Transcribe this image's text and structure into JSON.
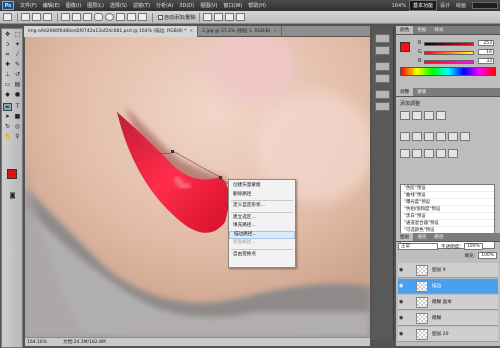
{
  "app": {
    "logo": "Ps"
  },
  "menubar": {
    "items": [
      "文件(F)",
      "编辑(E)",
      "图像(I)",
      "图层(L)",
      "选择(S)",
      "滤镜(T)",
      "分析(A)",
      "3D(D)",
      "视图(V)",
      "窗口(W)",
      "帮助(H)"
    ],
    "zoom": "164%",
    "workspaces": [
      "基本功能",
      "设计",
      "绘画"
    ]
  },
  "options_bar": {
    "auto_add_delete": "自动添加/删除"
  },
  "doc_tabs": [
    {
      "label": "img-a9d2066f6d80ed2f0742a13af24c681.psd @ 164% (描边, RGB/8) *",
      "active": true
    },
    {
      "label": "2.jpg @ 37.2% (图层 1, RGB/8)",
      "active": false
    }
  ],
  "status": {
    "zoom": "164.16%",
    "doc": "文档:24.3M/182.8M"
  },
  "context_menu": [
    {
      "label": "创建矢量蒙版",
      "type": "item"
    },
    {
      "label": "删除路径",
      "type": "item"
    },
    {
      "type": "sep"
    },
    {
      "label": "定义自定形状...",
      "type": "item"
    },
    {
      "type": "sep"
    },
    {
      "label": "建立选区...",
      "type": "item"
    },
    {
      "label": "填充路径...",
      "type": "item"
    },
    {
      "label": "描边路径...",
      "type": "highlighted"
    },
    {
      "label": "剪贴路径...",
      "type": "disabled"
    },
    {
      "type": "sep"
    },
    {
      "label": "自由变换点",
      "type": "item"
    }
  ],
  "color_panel": {
    "tabs": [
      "颜色",
      "色板",
      "样式"
    ],
    "swatch_color": "#fd1012",
    "sliders": [
      {
        "label": "R",
        "value": "253"
      },
      {
        "label": "G",
        "value": "16"
      },
      {
        "label": "B",
        "value": "33"
      }
    ]
  },
  "adjustments_panel": {
    "tabs": [
      "调整",
      "蒙版"
    ],
    "title": "添加调整",
    "presets": [
      "\"色阶\"预设",
      "\"曲线\"预设",
      "\"曝光度\"预设",
      "\"色相/饱和度\"预设",
      "\"黑白\"预设",
      "\"通道混合器\"预设",
      "\"可选颜色\"预设"
    ]
  },
  "layers_panel": {
    "tabs": [
      "图层",
      "通道",
      "路径"
    ],
    "blend_mode": "正常",
    "opacity_label": "不透明度:",
    "opacity": "100%",
    "fill_label": "填充:",
    "fill": "100%",
    "layers": [
      {
        "name": "图层 9",
        "selected": false
      },
      {
        "name": "描边",
        "selected": true
      },
      {
        "name": "模糊 副本",
        "selected": false
      },
      {
        "name": "模糊",
        "selected": false
      },
      {
        "name": "图层 20",
        "selected": false
      }
    ]
  },
  "colors": {
    "foreground": "#e01013",
    "background": "#ffffff",
    "highlight": "#4aa0f0"
  }
}
